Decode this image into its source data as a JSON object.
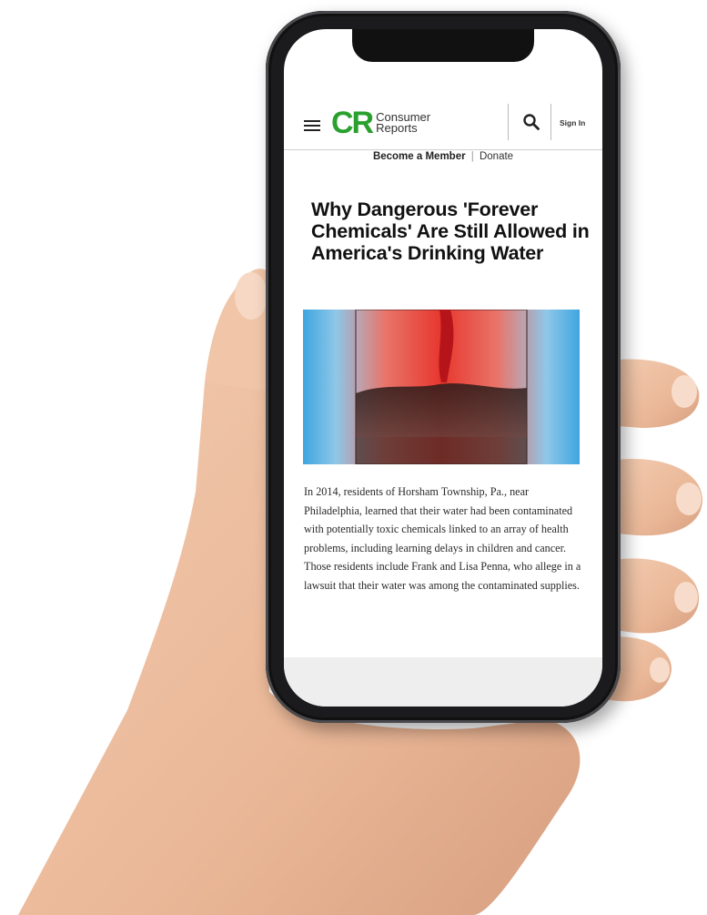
{
  "header": {
    "logo_mark": "CR",
    "logo_line1": "Consumer",
    "logo_line2": "Reports",
    "sign_in_label": "Sign In",
    "menu_icon": "hamburger-menu-icon",
    "search_icon": "search-icon"
  },
  "member_bar": {
    "member_label": "Become a Member",
    "separator": "|",
    "donate_label": "Donate"
  },
  "article": {
    "headline": "Why Dangerous 'Forever Chemicals' Are Still Allowed in America's Drinking Water",
    "body": "In 2014, residents of Horsham Township, Pa., near Philadelphia, learned that their water had been contaminated with potentially toxic chemicals linked to an array of health problems, including learning delays in children and cancer. Those residents include Frank and Lisa Penna, who allege in a lawsuit that their water was among the contaminated supplies."
  },
  "colors": {
    "brand_green": "#2aa12e",
    "hero_blue": "#3ea6e0",
    "hero_red": "#e5261c"
  }
}
